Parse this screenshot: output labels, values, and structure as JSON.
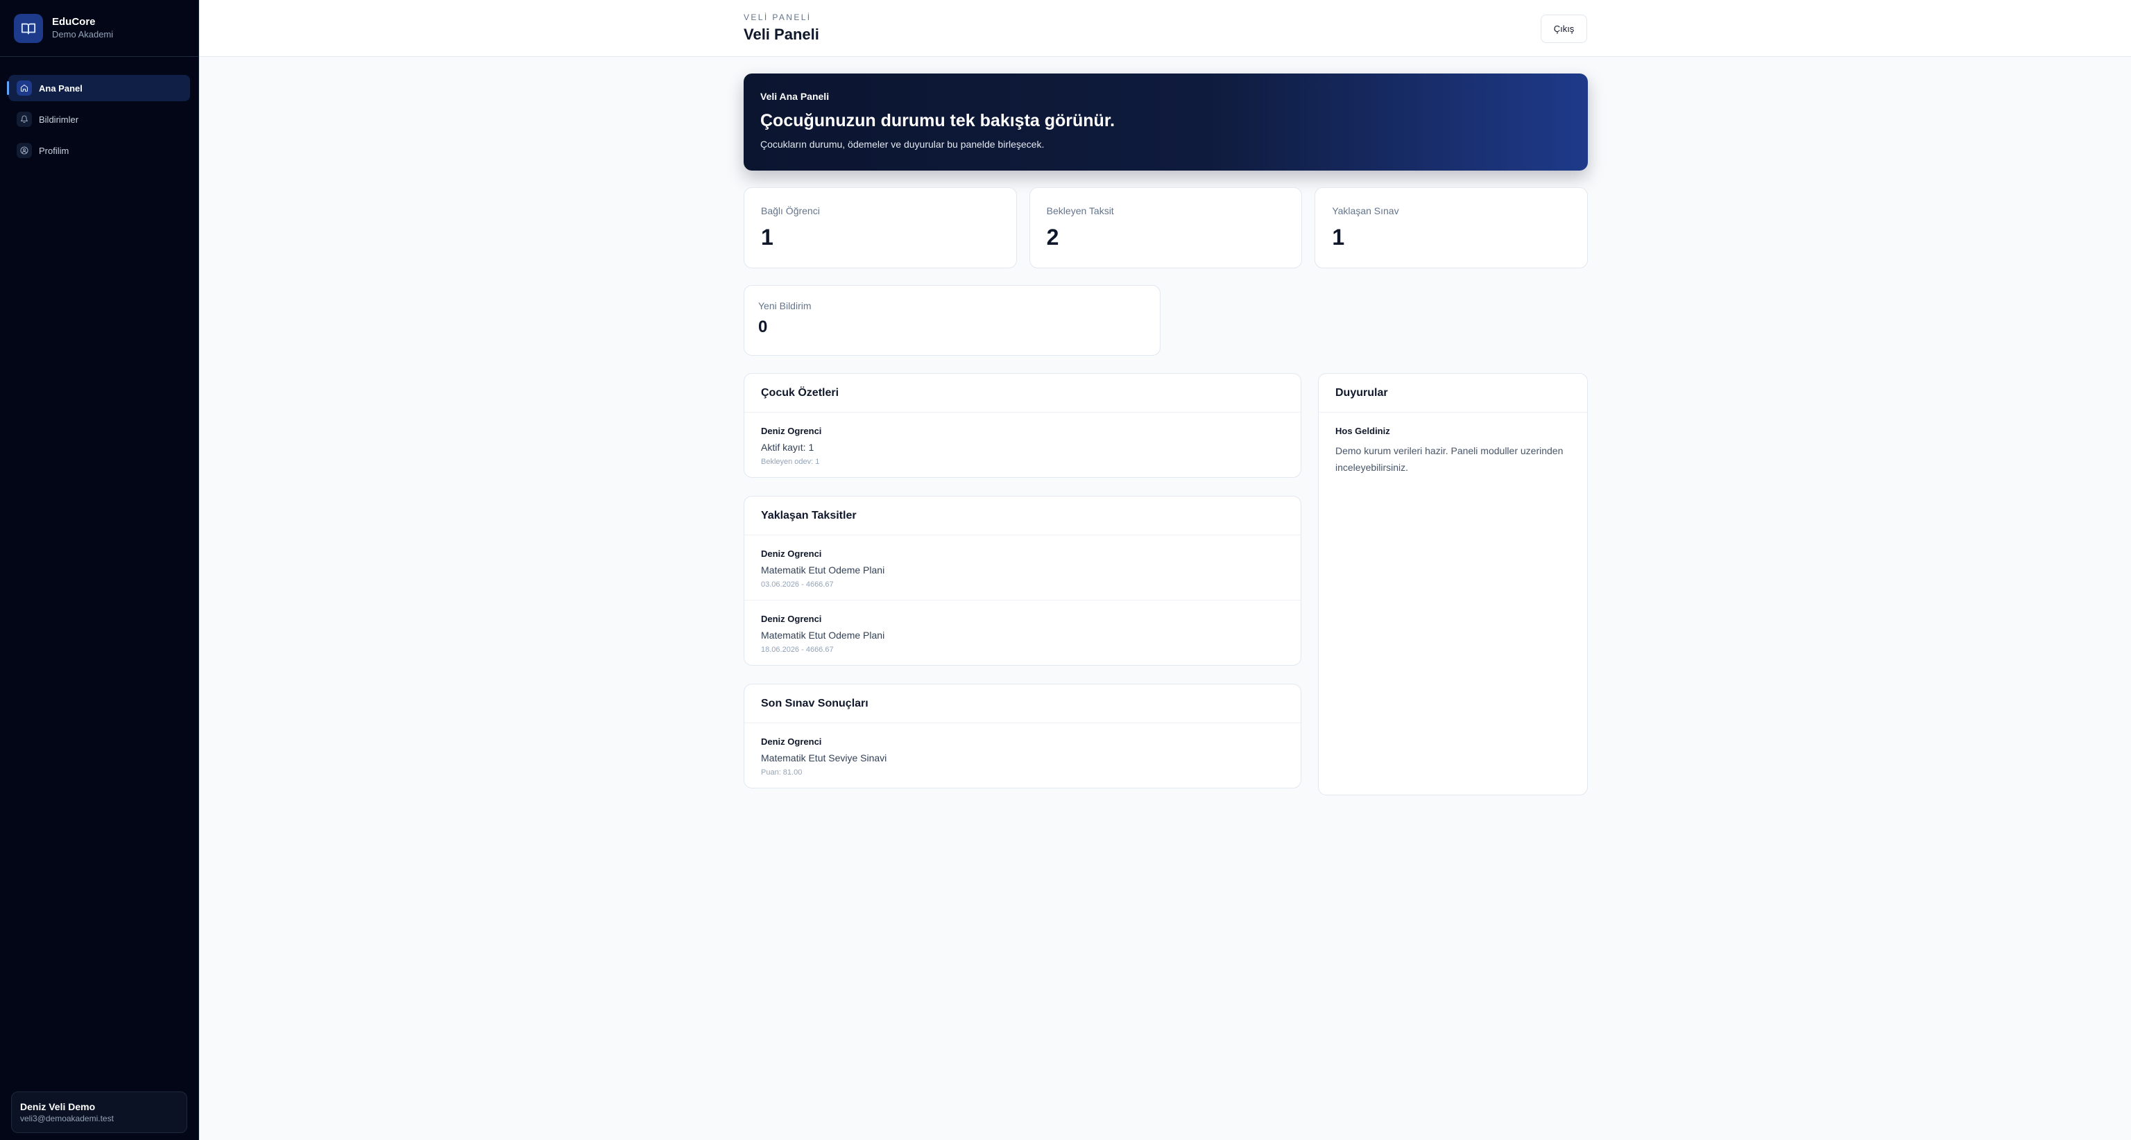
{
  "sidebar": {
    "brand": {
      "name": "EduCore",
      "subtitle": "Demo Akademi"
    },
    "items": [
      {
        "label": "Ana Panel",
        "icon": "home-icon",
        "active": true
      },
      {
        "label": "Bildirimler",
        "icon": "bell-icon",
        "active": false
      },
      {
        "label": "Profilim",
        "icon": "user-circle-icon",
        "active": false
      }
    ],
    "user": {
      "name": "Deniz Veli Demo",
      "email": "veli3@demoakademi.test"
    }
  },
  "header": {
    "eyebrow": "VELİ PANELİ",
    "title": "Veli Paneli",
    "logout_label": "Çıkış"
  },
  "hero": {
    "label": "Veli Ana Paneli",
    "title": "Çocuğunuzun durumu tek bakışta görünür.",
    "description": "Çocukların durumu, ödemeler ve duyurular bu panelde birleşecek."
  },
  "stats": [
    {
      "label": "Bağlı Öğrenci",
      "value": "1"
    },
    {
      "label": "Bekleyen Taksit",
      "value": "2"
    },
    {
      "label": "Yaklaşan Sınav",
      "value": "1"
    }
  ],
  "stat_small": {
    "label": "Yeni Bildirim",
    "value": "0"
  },
  "children_summary": {
    "title": "Çocuk Özetleri",
    "items": [
      {
        "name": "Deniz Ogrenci",
        "line": "Aktif kayıt: 1",
        "meta": "Bekleyen odev: 1"
      }
    ]
  },
  "installments": {
    "title": "Yaklaşan Taksitler",
    "items": [
      {
        "name": "Deniz Ogrenci",
        "line": "Matematik Etut Odeme Plani",
        "meta": "03.06.2026 - 4666.67"
      },
      {
        "name": "Deniz Ogrenci",
        "line": "Matematik Etut Odeme Plani",
        "meta": "18.06.2026 - 4666.67"
      }
    ]
  },
  "exam_results": {
    "title": "Son Sınav Sonuçları",
    "items": [
      {
        "name": "Deniz Ogrenci",
        "line": "Matematik Etut Seviye Sinavi",
        "meta": "Puan: 81.00"
      }
    ]
  },
  "announcements": {
    "title": "Duyurular",
    "items": [
      {
        "title": "Hos Geldiniz",
        "text": "Demo kurum verileri hazir. Paneli moduller uzerinden inceleyebilirsiniz."
      }
    ]
  },
  "colors": {
    "sidebar_bg": "#020617",
    "accent": "#1e3a8a",
    "page_bg": "#f8fafc"
  }
}
